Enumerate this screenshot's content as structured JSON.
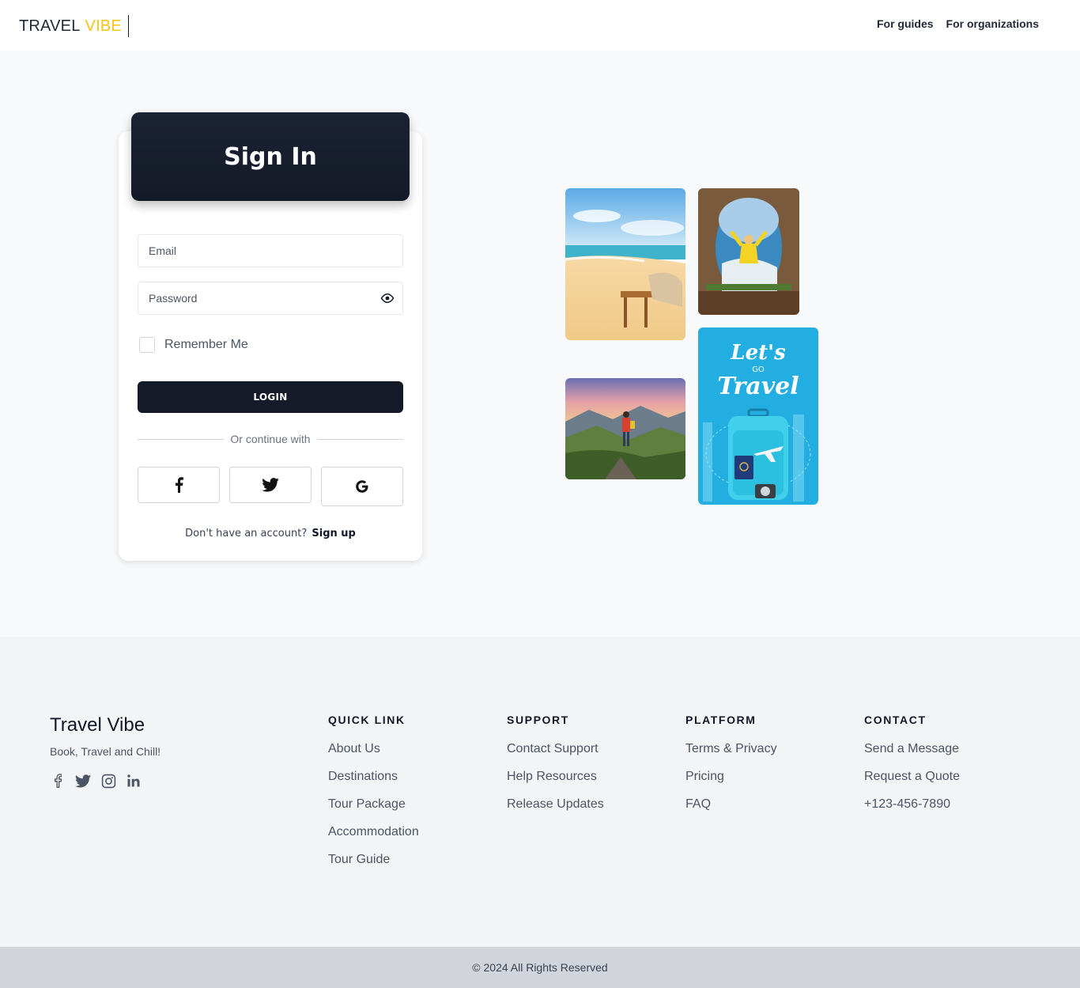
{
  "header": {
    "logo_part1": "TRAVEL",
    "logo_part2": "VIBE",
    "nav": [
      "For guides",
      "For organizations"
    ]
  },
  "signin": {
    "title": "Sign In",
    "email_placeholder": "Email",
    "password_placeholder": "Password",
    "remember_label": "Remember Me",
    "login_label": "LOGIN",
    "divider_text": "Or continue with",
    "signup_prompt": "Don't have an account?",
    "signup_link": "Sign up"
  },
  "collage": {
    "poster_text_1": "Let's",
    "poster_text_2": "GO",
    "poster_text_3": "Travel"
  },
  "footer": {
    "brand": "Travel Vibe",
    "tagline": "Book, Travel and Chill!",
    "columns": [
      {
        "title": "QUICK LINK",
        "links": [
          "About Us",
          "Destinations",
          "Tour Package",
          "Accommodation",
          "Tour Guide"
        ]
      },
      {
        "title": "SUPPORT",
        "links": [
          "Contact Support",
          "Help Resources",
          "Release Updates"
        ]
      },
      {
        "title": "PLATFORM",
        "links": [
          "Terms & Privacy",
          "Pricing",
          "FAQ"
        ]
      },
      {
        "title": "CONTACT",
        "links": [
          "Send a Message",
          "Request a Quote",
          "+123-456-7890"
        ]
      }
    ],
    "copyright": "© 2024 All Rights Reserved"
  },
  "colors": {
    "accent": "#f5c518",
    "dark": "#141a27"
  }
}
